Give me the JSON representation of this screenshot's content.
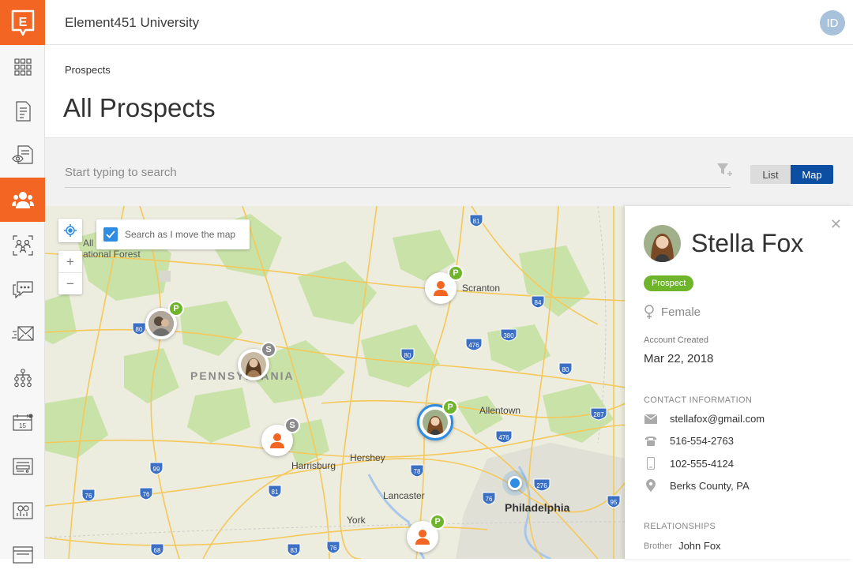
{
  "app": {
    "university": "Element451 University",
    "user_initials": "ID",
    "brand_color": "#f26522",
    "logo_letter": "E"
  },
  "sidebar": {
    "items": [
      {
        "icon": "grid-icon",
        "active": false
      },
      {
        "icon": "document-icon",
        "active": false
      },
      {
        "icon": "eye-document-icon",
        "active": false
      },
      {
        "icon": "people-icon",
        "active": true
      },
      {
        "icon": "segments-icon",
        "active": false
      },
      {
        "icon": "chat-icon",
        "active": false
      },
      {
        "icon": "mail-icon",
        "active": false
      },
      {
        "icon": "org-chart-icon",
        "active": false
      },
      {
        "icon": "calendar-icon",
        "active": false
      },
      {
        "icon": "form-icon",
        "active": false
      },
      {
        "icon": "reports-icon",
        "active": false
      },
      {
        "icon": "layout-icon",
        "active": false
      }
    ]
  },
  "page": {
    "breadcrumb": "Prospects",
    "title": "All Prospects"
  },
  "search": {
    "placeholder": "Start typing to search",
    "view_list": "List",
    "view_map": "Map",
    "active_view": "Map"
  },
  "map": {
    "search_as_move": "Search as I move the map",
    "zoom_in": "+",
    "zoom_out": "−",
    "labels": {
      "forest": "All\national Forest",
      "state": "PENNSYLVANIA",
      "scranton": "Scranton",
      "allentown": "Allentown",
      "hershey": "Hershey",
      "harrisburg": "Harrisburg",
      "lancaster": "Lancaster",
      "york": "York",
      "philadelphia": "Philadelphia"
    },
    "shields": [
      "81",
      "84",
      "380",
      "476",
      "80",
      "80",
      "80",
      "287",
      "476",
      "78",
      "99",
      "76",
      "76",
      "81",
      "76",
      "76",
      "276",
      "95",
      "68",
      "83"
    ],
    "pins": [
      {
        "badge": "P",
        "type": "photo"
      },
      {
        "badge": "S",
        "type": "photo"
      },
      {
        "badge": "P",
        "type": "person"
      },
      {
        "badge": "P",
        "type": "photo",
        "selected": true
      },
      {
        "badge": "S",
        "type": "person"
      },
      {
        "badge": "P",
        "type": "person"
      }
    ]
  },
  "profile": {
    "name": "Stella Fox",
    "tag": "Prospect",
    "gender": "Female",
    "account_created_label": "Account Created",
    "account_created": "Mar 22, 2018",
    "contact_label": "CONTACT INFORMATION",
    "email": "stellafox@gmail.com",
    "phone": "516-554-2763",
    "mobile": "102-555-4124",
    "location": "Berks County, PA",
    "relationships_label": "RELATIONSHIPS",
    "relationships": [
      {
        "relation": "Brother",
        "name": "John Fox"
      }
    ]
  }
}
